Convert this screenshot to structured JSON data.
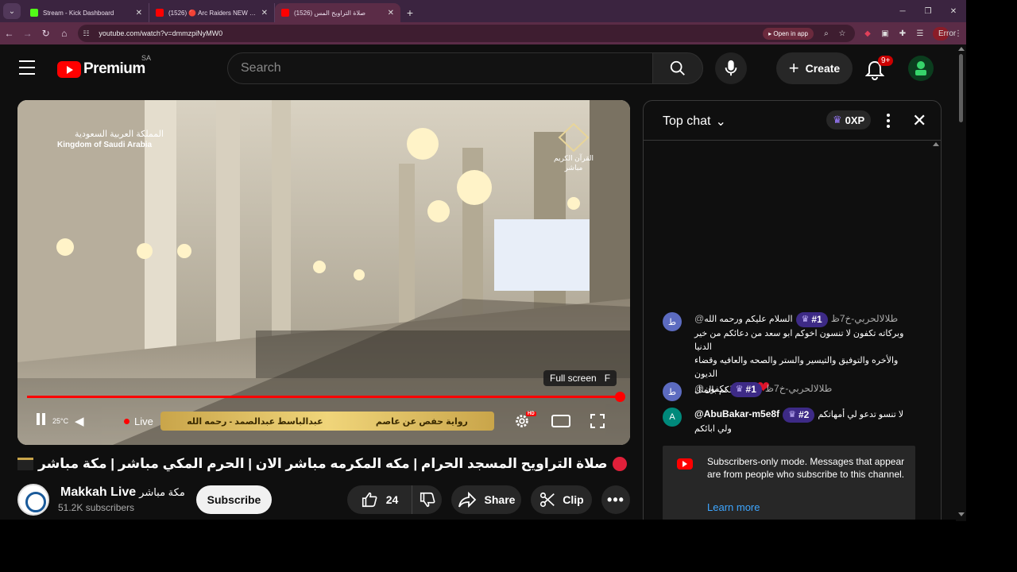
{
  "browser": {
    "tabs": [
      {
        "title": "Stream - Kick Dashboard",
        "favicon_color": "#53fc18",
        "active": false
      },
      {
        "title": "(1526) 🔴 Arc Raiders NEW EXP",
        "favicon_color": "#ff0000",
        "active": false
      },
      {
        "title": "(1526) صلاة التراويح المس",
        "favicon_color": "#ff0000",
        "active": true
      }
    ],
    "url": "youtube.com/watch?v=dmmzpiNyMW0",
    "open_in_app": "Open in app",
    "error_label": "Error"
  },
  "youtube": {
    "logo_text": "Premium",
    "country_code": "SA",
    "search_placeholder": "Search",
    "create_label": "Create",
    "notifications_badge": "9+"
  },
  "player": {
    "overlay_title_ar": "المملكة العربية السعودية",
    "overlay_title_en": "Kingdom of Saudi Arabia",
    "channel_mark_ar": "القرآن الكريم",
    "channel_mark_live": "مباشر",
    "fullscreen_tooltip": "Full screen",
    "fullscreen_key": "F",
    "temperature": "25°C",
    "live_label": "Live",
    "banner_left": "رواية حفص عن عاصم",
    "banner_right": "عبدالباسط عبدالصمد - رحمه الله",
    "hd_badge": "HD",
    "progress": 1.0
  },
  "video": {
    "title": "صلاة التراويح المسجد الحرام | مكه المكرمه مباشر الان | الحرم المكي مباشر | مكة مباشر",
    "channel_name": "Makkah Live",
    "channel_name_ar": "مكة مباشر",
    "subscribers": "51.2K subscribers",
    "subscribe_label": "Subscribe",
    "likes": "24",
    "share_label": "Share",
    "clip_label": "Clip"
  },
  "chat": {
    "header": "Top chat",
    "xp": "0XP",
    "messages": [
      {
        "avatar_letter": "ط",
        "avatar_color": "#5c6bc0",
        "author": "@طلالالحربي-خ7ظ",
        "rank": "#1",
        "lines": [
          "السلام عليكم ورحمه الله",
          "وبركاته تكفون لا تنسون اخوكم ابو سعد من دعائكم من خير الدنيا",
          "والأخره والتوفيق والتيسير والستر والصحه والعافيه وقضاء الديون",
          "ولكم بالمثل"
        ],
        "hearts": "❤ ❤"
      },
      {
        "avatar_letter": "ط",
        "avatar_color": "#5c6bc0",
        "author": "@طلالالحربي-خ7ظ",
        "rank": "#1",
        "lines": [
          "تكفون"
        ]
      },
      {
        "avatar_letter": "A",
        "avatar_color": "#00897b",
        "author": "@AbuBakar-m5e8f",
        "rank": "#2",
        "lines": [
          "لا تنسو تدعو لي أمهاتكم",
          "ولي ابائكم"
        ]
      }
    ],
    "subscribers_only_text": "Subscribers-only mode. Messages that appear are from people who subscribe to this channel.",
    "learn_more": "Learn more"
  }
}
